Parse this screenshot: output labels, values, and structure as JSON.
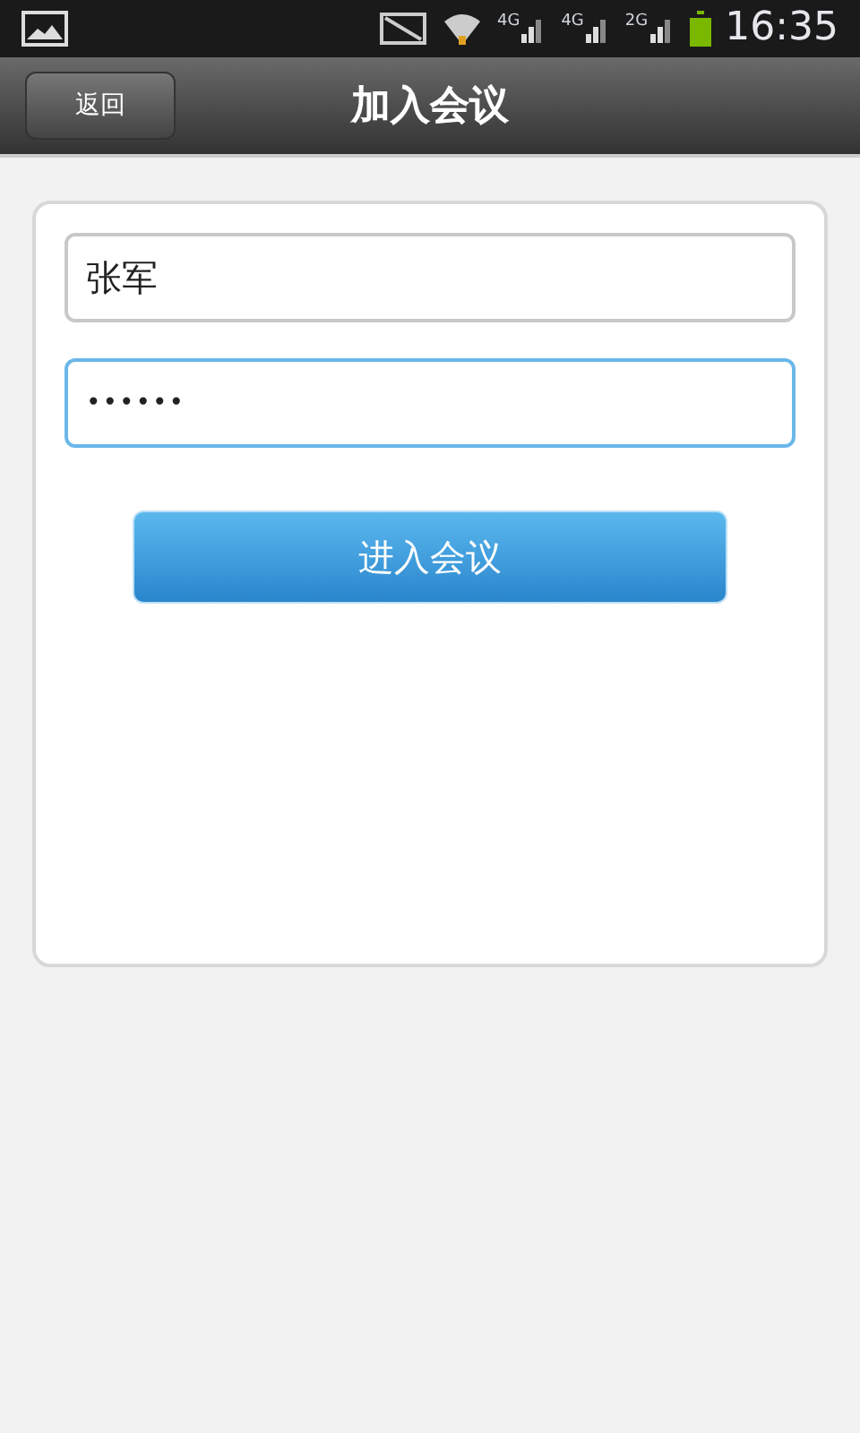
{
  "status_bar": {
    "networks": [
      "4G",
      "4G",
      "2G"
    ],
    "time": "16:35"
  },
  "header": {
    "back_button": "返回",
    "title": "加入会议"
  },
  "form": {
    "fields": [
      {
        "kind": "text",
        "value": "张军",
        "focused": false
      },
      {
        "kind": "password",
        "value": "••••••",
        "focused": true
      }
    ],
    "submit_button": "进入会议"
  }
}
